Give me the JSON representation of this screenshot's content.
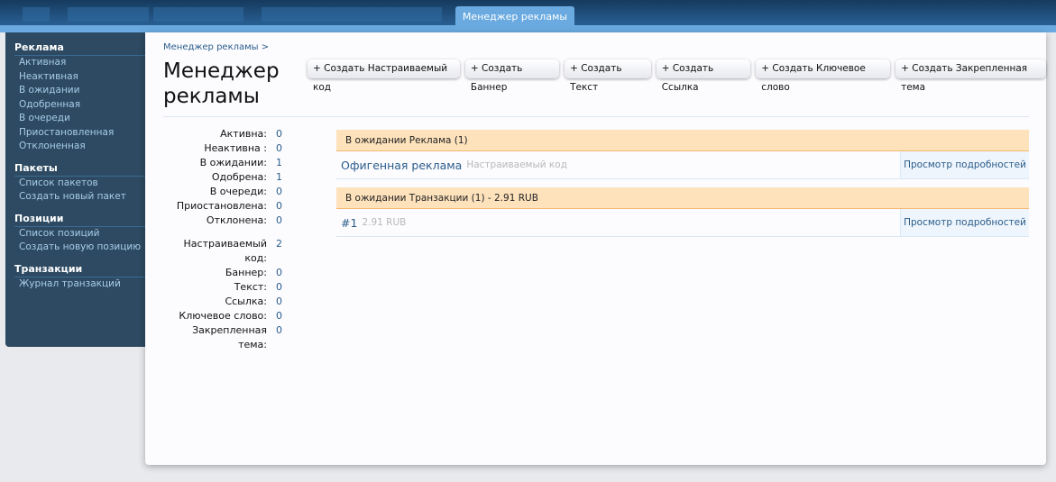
{
  "nav": {
    "tab": "Менеджер рекламы"
  },
  "sidebar": [
    {
      "title": "Реклама",
      "items": [
        "Активная",
        "Неактивная",
        "В ожидании",
        "Одобренная",
        "В очереди",
        "Приостановленная",
        "Отклоненная"
      ]
    },
    {
      "title": "Пакеты",
      "items": [
        "Список пакетов",
        "Создать новый пакет"
      ]
    },
    {
      "title": "Позиции",
      "items": [
        "Список позиций",
        "Создать новую позицию"
      ]
    },
    {
      "title": "Транзакции",
      "items": [
        "Журнал транзакций"
      ]
    }
  ],
  "main": {
    "breadcrumb": "Менеджер рекламы >",
    "title": "Менеджер рекламы",
    "buttons": [
      "+ Создать Настраиваемый код",
      "+ Создать Баннер",
      "+ Создать Текст",
      "+ Создать Ссылка",
      "+ Создать Ключевое слово",
      "+ Создать Закрепленная тема"
    ],
    "stats_status": [
      {
        "label": "Активна:",
        "value": "0"
      },
      {
        "label": "Неактивна :",
        "value": "0"
      },
      {
        "label": "В ожидании:",
        "value": "1"
      },
      {
        "label": "Одобрена:",
        "value": "1"
      },
      {
        "label": "В очереди:",
        "value": "0"
      },
      {
        "label": "Приостановлена:",
        "value": "0"
      },
      {
        "label": "Отклонена:",
        "value": "0"
      }
    ],
    "stats_type": [
      {
        "label": "Настраиваемый код:",
        "value": "2"
      },
      {
        "label": "Баннер:",
        "value": "0"
      },
      {
        "label": "Текст:",
        "value": "0"
      },
      {
        "label": "Ссылка:",
        "value": "0"
      },
      {
        "label": "Ключевое слово:",
        "value": "0"
      },
      {
        "label": "Закрепленная тема:",
        "value": "0"
      }
    ],
    "sections": [
      {
        "header": "В ожидании Реклама (1)",
        "name": "Офигенная реклама",
        "sub": "Настраиваемый код",
        "details": "Просмотр подробностей"
      },
      {
        "header": "В ожидании Транзакции (1) - 2.91 RUB",
        "name": "#1",
        "sub": "2.91 RUB",
        "details": "Просмотр подробностей"
      }
    ]
  }
}
